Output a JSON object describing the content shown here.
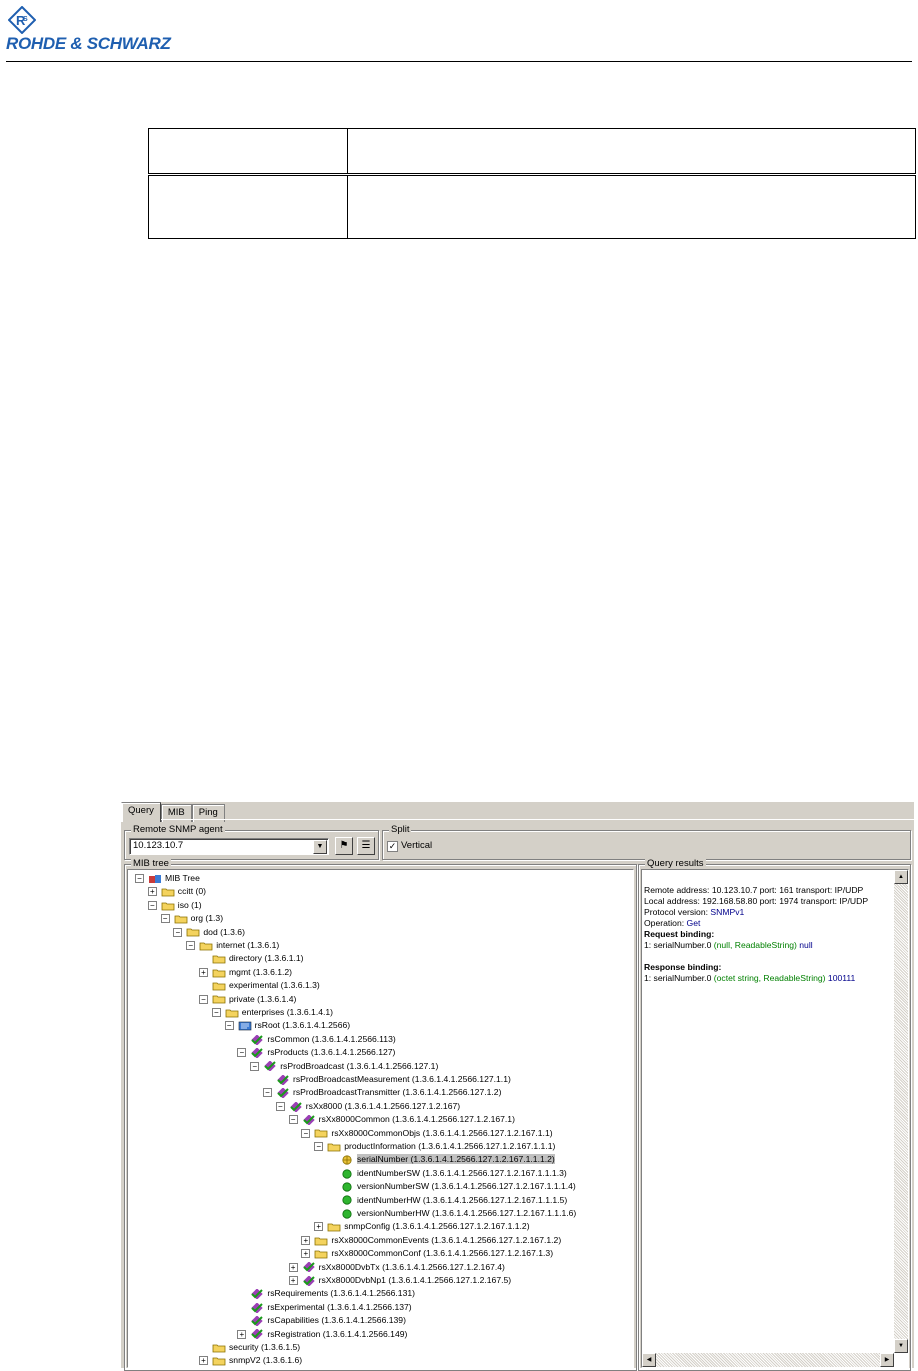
{
  "header": {
    "logo_text": "ROHDE & SCHWARZ"
  },
  "app": {
    "tabs": [
      {
        "label": "Query"
      },
      {
        "label": "MIB"
      },
      {
        "label": "Ping"
      }
    ],
    "remote_agent_group": "Remote SNMP agent",
    "remote_agent_value": "10.123.10.7",
    "split_group": "Split",
    "vertical_label": "Vertical",
    "mib_tree_group": "MIB tree",
    "query_results_group": "Query results",
    "tree": [
      {
        "label": "MIB Tree",
        "depth": 0,
        "icon": "tree-root-icon",
        "exp": "-"
      },
      {
        "label": "ccitt (0)",
        "depth": 1,
        "icon": "folder-icon",
        "exp": "+"
      },
      {
        "label": "iso (1)",
        "depth": 1,
        "icon": "folder-icon",
        "exp": "-"
      },
      {
        "label": "org (1.3)",
        "depth": 2,
        "icon": "folder-icon",
        "exp": "-"
      },
      {
        "label": "dod (1.3.6)",
        "depth": 3,
        "icon": "folder-icon",
        "exp": "-"
      },
      {
        "label": "internet (1.3.6.1)",
        "depth": 4,
        "icon": "folder-icon",
        "exp": "-"
      },
      {
        "label": "directory (1.3.6.1.1)",
        "depth": 5,
        "icon": "folder-icon",
        "exp": ""
      },
      {
        "label": "mgmt (1.3.6.1.2)",
        "depth": 5,
        "icon": "folder-icon",
        "exp": "+"
      },
      {
        "label": "experimental (1.3.6.1.3)",
        "depth": 5,
        "icon": "folder-icon",
        "exp": ""
      },
      {
        "label": "private (1.3.6.1.4)",
        "depth": 5,
        "icon": "folder-icon",
        "exp": "-"
      },
      {
        "label": "enterprises (1.3.6.1.4.1)",
        "depth": 6,
        "icon": "folder-icon",
        "exp": "-"
      },
      {
        "label": "rsRoot (1.3.6.1.4.1.2566)",
        "depth": 7,
        "icon": "rs-root-icon",
        "exp": "-"
      },
      {
        "label": "rsCommon (1.3.6.1.4.1.2566.113)",
        "depth": 8,
        "icon": "check-icon",
        "exp": ""
      },
      {
        "label": "rsProducts (1.3.6.1.4.1.2566.127)",
        "depth": 8,
        "icon": "check-icon",
        "exp": "-"
      },
      {
        "label": "rsProdBroadcast (1.3.6.1.4.1.2566.127.1)",
        "depth": 9,
        "icon": "check-icon",
        "exp": "-"
      },
      {
        "label": "rsProdBroadcastMeasurement (1.3.6.1.4.1.2566.127.1.1)",
        "depth": 10,
        "icon": "check-icon",
        "exp": ""
      },
      {
        "label": "rsProdBroadcastTransmitter (1.3.6.1.4.1.2566.127.1.2)",
        "depth": 10,
        "icon": "check-icon",
        "exp": "-"
      },
      {
        "label": "rsXx8000 (1.3.6.1.4.1.2566.127.1.2.167)",
        "depth": 11,
        "icon": "check-icon",
        "exp": "-"
      },
      {
        "label": "rsXx8000Common (1.3.6.1.4.1.2566.127.1.2.167.1)",
        "depth": 12,
        "icon": "check-icon",
        "exp": "-"
      },
      {
        "label": "rsXx8000CommonObjs (1.3.6.1.4.1.2566.127.1.2.167.1.1)",
        "depth": 13,
        "icon": "folder-icon",
        "exp": "-"
      },
      {
        "label": "productInformation (1.3.6.1.4.1.2566.127.1.2.167.1.1.1)",
        "depth": 14,
        "icon": "folder-icon",
        "exp": "-"
      },
      {
        "label": "serialNumber (1.3.6.1.4.1.2566.127.1.2.167.1.1.1.2)",
        "depth": 15,
        "icon": "leaf-selected-icon",
        "exp": "",
        "selected": true
      },
      {
        "label": "identNumberSW (1.3.6.1.4.1.2566.127.1.2.167.1.1.1.3)",
        "depth": 15,
        "icon": "leaf-icon",
        "exp": ""
      },
      {
        "label": "versionNumberSW (1.3.6.1.4.1.2566.127.1.2.167.1.1.1.4)",
        "depth": 15,
        "icon": "leaf-icon",
        "exp": ""
      },
      {
        "label": "identNumberHW (1.3.6.1.4.1.2566.127.1.2.167.1.1.1.5)",
        "depth": 15,
        "icon": "leaf-icon",
        "exp": ""
      },
      {
        "label": "versionNumberHW (1.3.6.1.4.1.2566.127.1.2.167.1.1.1.6)",
        "depth": 15,
        "icon": "leaf-icon",
        "exp": ""
      },
      {
        "label": "snmpConfig (1.3.6.1.4.1.2566.127.1.2.167.1.1.2)",
        "depth": 14,
        "icon": "folder-icon",
        "exp": "+"
      },
      {
        "label": "rsXx8000CommonEvents (1.3.6.1.4.1.2566.127.1.2.167.1.2)",
        "depth": 13,
        "icon": "folder-icon",
        "exp": "+"
      },
      {
        "label": "rsXx8000CommonConf (1.3.6.1.4.1.2566.127.1.2.167.1.3)",
        "depth": 13,
        "icon": "folder-icon",
        "exp": "+"
      },
      {
        "label": "rsXx8000DvbTx (1.3.6.1.4.1.2566.127.1.2.167.4)",
        "depth": 12,
        "icon": "check-icon",
        "exp": "+"
      },
      {
        "label": "rsXx8000DvbNp1 (1.3.6.1.4.1.2566.127.1.2.167.5)",
        "depth": 12,
        "icon": "check-icon",
        "exp": "+"
      },
      {
        "label": "rsRequirements (1.3.6.1.4.1.2566.131)",
        "depth": 8,
        "icon": "check-icon",
        "exp": ""
      },
      {
        "label": "rsExperimental (1.3.6.1.4.1.2566.137)",
        "depth": 8,
        "icon": "check-icon",
        "exp": ""
      },
      {
        "label": "rsCapabilities (1.3.6.1.4.1.2566.139)",
        "depth": 8,
        "icon": "check-icon",
        "exp": ""
      },
      {
        "label": "rsRegistration (1.3.6.1.4.1.2566.149)",
        "depth": 8,
        "icon": "check-icon",
        "exp": "+"
      },
      {
        "label": "security (1.3.6.1.5)",
        "depth": 5,
        "icon": "folder-icon",
        "exp": ""
      },
      {
        "label": "snmpV2 (1.3.6.1.6)",
        "depth": 5,
        "icon": "folder-icon",
        "exp": "+"
      }
    ],
    "results": {
      "remote_prefix": "Remote address: 10.123.10.7  port: 161 transport: IP/UDP",
      "local_prefix": "Local address: 192.168.58.80  port: 1974 transport: IP/UDP",
      "protocol_label": "Protocol version: ",
      "protocol_value": "SNMPv1",
      "operation_label": "Operation: ",
      "operation_value": "Get",
      "request_heading": "Request binding:",
      "request_name": "1: serialNumber.0 ",
      "request_type": "(null, ReadableString)",
      "request_value": " null",
      "response_heading": "Response binding:",
      "response_name": "1: serialNumber.0 ",
      "response_type": "(octet string, ReadableString)",
      "response_value": " 100111"
    }
  }
}
